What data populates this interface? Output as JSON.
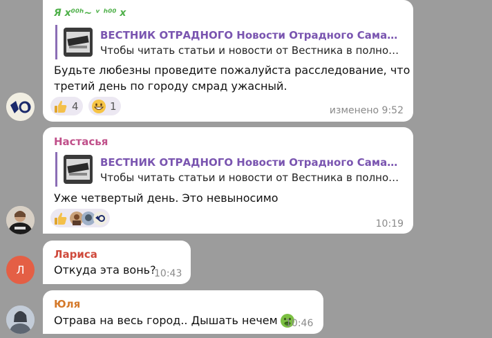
{
  "messages": [
    {
      "sender": "Я x⁰⁰ʰ~ ᵛ ʰ⁰⁰ x",
      "quote_title": "ВЕСТНИК ОТРАДНОГО Новости Отрадного Самарска...",
      "quote_text": "Чтобы читать статьи и новости от Вестника в полном ...",
      "text_line1": "Будьте любезны проведите пожалуйста расследование, что",
      "text_line2": "третий день по городу смрад ужасный.",
      "reactions": [
        {
          "icon": "thumbs-up-icon",
          "count": "4"
        },
        {
          "icon": "grinning-face-icon",
          "count": "1"
        }
      ],
      "time": "изменено 9:52"
    },
    {
      "sender": "Настасья",
      "sender_color": "#c0508a",
      "quote_title": "ВЕСТНИК ОТРАДНОГО Новости Отрадного Самарска...",
      "quote_text": "Чтобы читать статьи и новости от Вестника в полном ...",
      "text": "Уже четвертый день. Это невыносимо",
      "reaction_icon": "thumbs-up-icon",
      "time": "10:19"
    },
    {
      "sender": "Лариса",
      "sender_color": "#cf4a3c",
      "avatar_letter": "Л",
      "text": "Откуда эта вонь?",
      "time": "10:43"
    },
    {
      "sender": "Юля",
      "sender_color": "#d4792a",
      "text": "Отрава на весь город.. Дышать нечем",
      "emoji": "nauseated-face-icon",
      "time": "10:46"
    }
  ],
  "colors": {
    "background": "#9c9c9c",
    "bubble": "#ffffff",
    "link_title": "#7a55b0",
    "time": "#8a8a8a"
  }
}
